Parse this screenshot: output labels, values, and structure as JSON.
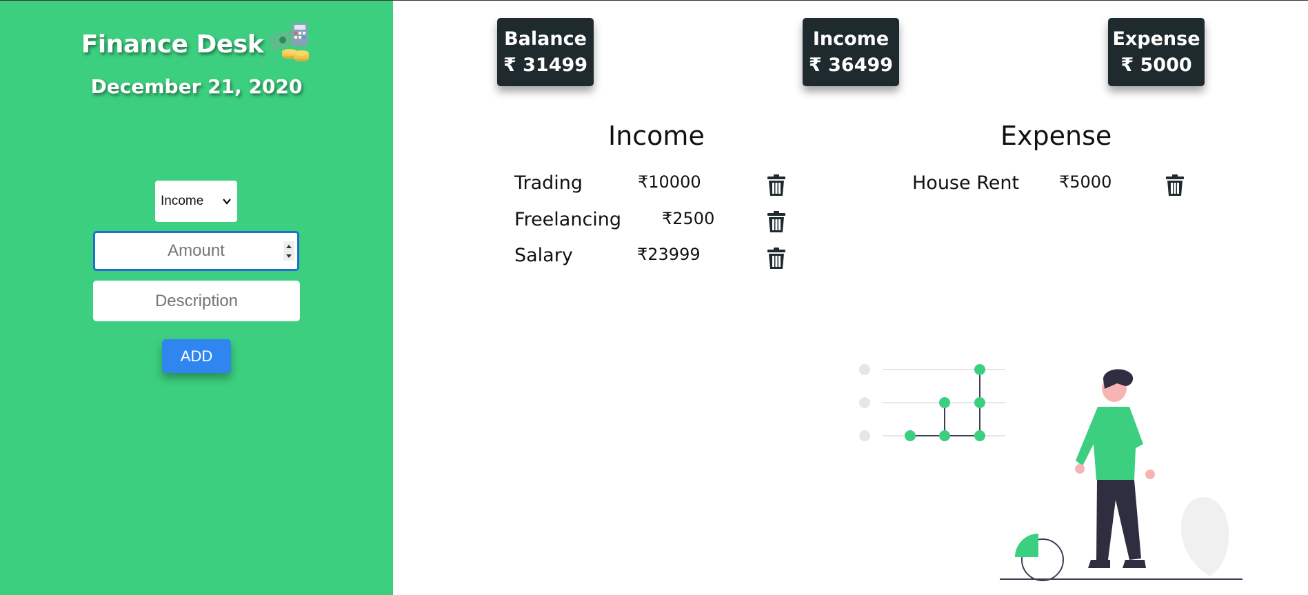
{
  "sidebar": {
    "title": "Finance Desk",
    "date": "December 21, 2020",
    "type_select": {
      "selected": "Income"
    },
    "amount_placeholder": "Amount",
    "description_placeholder": "Description",
    "add_label": "ADD"
  },
  "summary": {
    "balance": {
      "label": "Balance",
      "value": "₹ 31499"
    },
    "income": {
      "label": "Income",
      "value": "₹ 36499"
    },
    "expense": {
      "label": "Expense",
      "value": "₹ 5000"
    }
  },
  "income_list": {
    "title": "Income",
    "items": [
      {
        "label": "Trading",
        "amount": "₹10000"
      },
      {
        "label": "Freelancing",
        "amount": "₹2500"
      },
      {
        "label": "Salary",
        "amount": "₹23999"
      }
    ]
  },
  "expense_list": {
    "title": "Expense",
    "items": [
      {
        "label": "House Rent",
        "amount": "₹5000"
      }
    ]
  },
  "colors": {
    "sidebar_bg": "#3ccf7f",
    "card_bg": "#1e2a2e",
    "accent_green": "#3ccf7f",
    "button_blue": "#2f86f0"
  },
  "icons": {
    "brand": "money-calculator-icon",
    "delete": "trash-icon",
    "select": "chevron-down-icon"
  }
}
